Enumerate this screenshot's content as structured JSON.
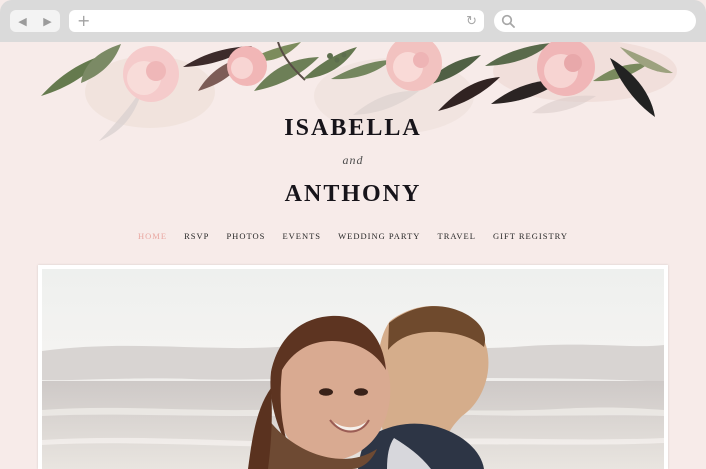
{
  "browser": {
    "back_icon": "back-arrow-icon",
    "forward_icon": "forward-arrow-icon",
    "new_tab_icon": "plus-icon",
    "reload_icon": "reload-icon",
    "search_icon": "magnifier-icon"
  },
  "wedding": {
    "name_first": "ISABELLA",
    "conjunction": "and",
    "name_second": "ANTHONY"
  },
  "nav": {
    "items": [
      {
        "label": "HOME",
        "active": true
      },
      {
        "label": "RSVP"
      },
      {
        "label": "PHOTOS"
      },
      {
        "label": "EVENTS"
      },
      {
        "label": "WEDDING PARTY"
      },
      {
        "label": "TRAVEL"
      },
      {
        "label": "GIFT REGISTRY"
      }
    ]
  },
  "colors": {
    "page_background": "#f7ebe9",
    "nav_active": "#e9a7a1",
    "text": "#17141a"
  }
}
